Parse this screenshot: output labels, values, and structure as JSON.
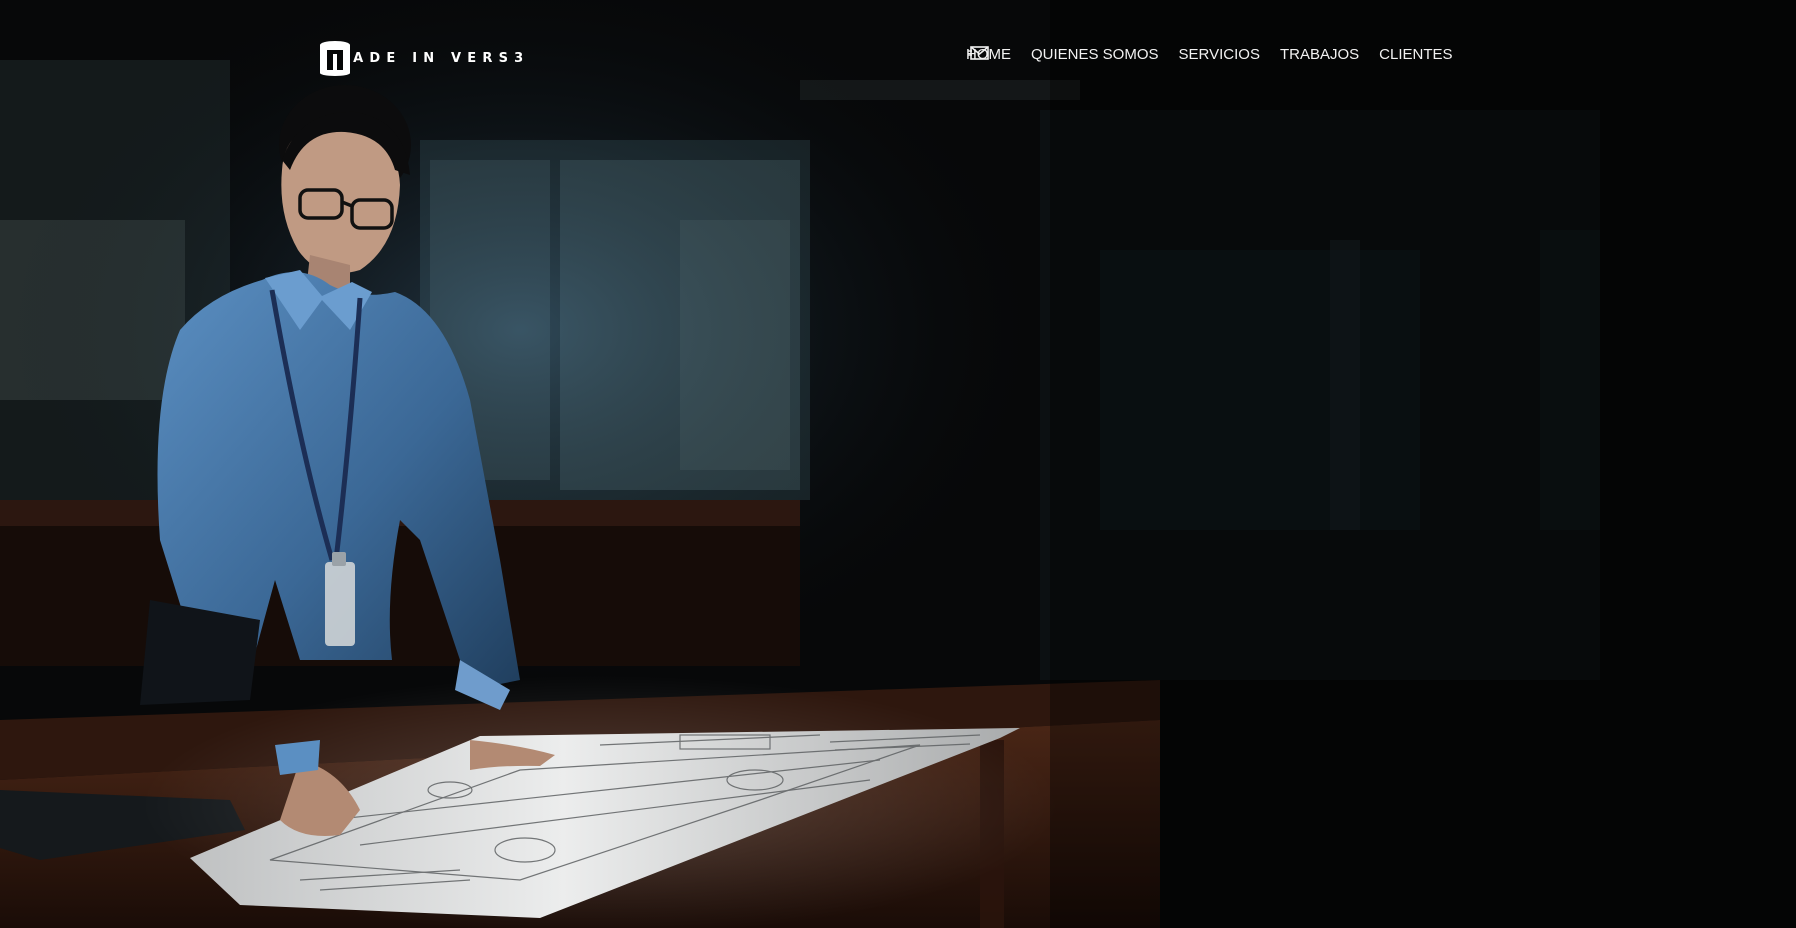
{
  "brand": {
    "name": "MADE IN VERS3",
    "logo_icon": "cylinder-logo-icon"
  },
  "nav": {
    "items": [
      {
        "label": "HOME"
      },
      {
        "label": "QUIENES SOMOS"
      },
      {
        "label": "SERVICIOS"
      },
      {
        "label": "TRABAJOS"
      },
      {
        "label": "CLIENTES"
      }
    ],
    "contact_icon": "envelope-icon"
  },
  "colors": {
    "background": "#050606",
    "nav_text": "#f2f2f2",
    "shirt_blue": "#3f6e9e",
    "table_wood": "#3a1f14",
    "blueprint": "#d9dadb"
  }
}
